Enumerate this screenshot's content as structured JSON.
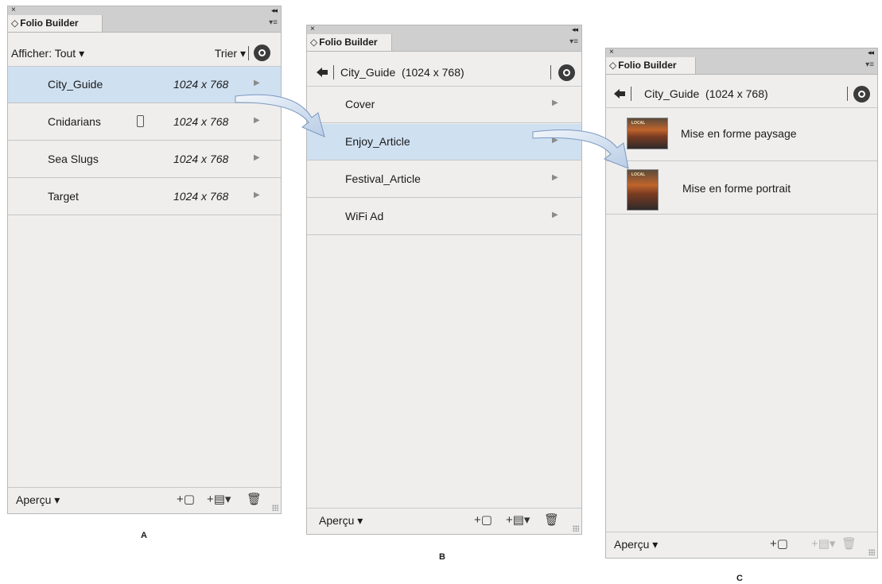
{
  "common": {
    "close_glyph": "×",
    "collapse_glyph": "◂◂",
    "tab_glyph": "◇",
    "tab_title": "Folio Builder",
    "panel_menu_glyph": "▾≡",
    "row_arrow_glyph": "▶",
    "preview_label": "Aperçu ▾",
    "new_article_glyph": "+▢",
    "add_menu_glyph": "+▤▾",
    "delete_glyph": "🗑"
  },
  "panelA": {
    "label": "A",
    "filter_label": "Afficher: Tout ▾",
    "sort_label": "Trier ▾",
    "folios": [
      {
        "name": "City_Guide",
        "size": "1024 x 768",
        "selected": true,
        "device_icon": false
      },
      {
        "name": "Cnidarians",
        "size": "1024 x 768",
        "selected": false,
        "device_icon": true
      },
      {
        "name": "Sea Slugs",
        "size": "1024 x 768",
        "selected": false,
        "device_icon": false
      },
      {
        "name": "Target",
        "size": "1024 x 768",
        "selected": false,
        "device_icon": false
      }
    ]
  },
  "panelB": {
    "label": "B",
    "breadcrumb": "City_Guide  (1024 x 768)",
    "articles": [
      {
        "name": "Cover",
        "selected": false
      },
      {
        "name": "Enjoy_Article",
        "selected": true
      },
      {
        "name": "Festival_Article",
        "selected": false
      },
      {
        "name": "WiFi Ad",
        "selected": false
      }
    ]
  },
  "panelC": {
    "label": "C",
    "breadcrumb": "City_Guide  (1024 x 768)",
    "thumb_text": "LOCAL",
    "layouts": [
      {
        "name": "Mise en forme paysage",
        "orientation": "landscape"
      },
      {
        "name": "Mise en forme portrait",
        "orientation": "portrait"
      }
    ]
  }
}
